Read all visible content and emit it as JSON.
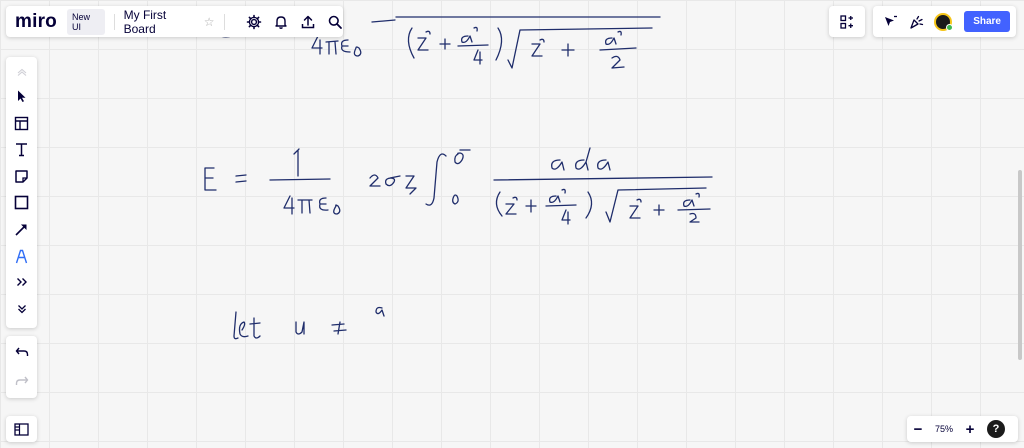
{
  "topbar": {
    "logo": "miro",
    "badge": "New UI",
    "board_title": "My First Board",
    "icons": [
      "settings-icon",
      "bell-icon",
      "upload-icon",
      "search-icon"
    ]
  },
  "topright": {
    "share_label": "Share",
    "icons": [
      "apps-icon",
      "cursor-icon",
      "reactions-icon",
      "avatar"
    ]
  },
  "toolbar": {
    "tools": [
      "chevron-up-icon",
      "select-icon",
      "template-icon",
      "text-icon",
      "sticky-note-icon",
      "shape-icon",
      "arrow-icon",
      "pen-icon",
      "more-icon",
      "chevron-down-icon"
    ]
  },
  "undo": [
    "undo-icon",
    "redo-icon"
  ],
  "zoom": {
    "level": "75%",
    "minus": "−",
    "plus": "+",
    "help": "?"
  },
  "colors": {
    "accent": "#4262ff",
    "ink": "#1f2d6b",
    "pen_tool": "#2f6df6"
  },
  "handwriting": {
    "line1_denominator": "(z² + a²/4) √(z² + a²/2)",
    "line1_lhs": "4πε₀",
    "line2_lhs": "E",
    "line2_equals": "=",
    "line2_numerator": "1",
    "line2_denominator": "4πε₀",
    "line2_factor": "2σz",
    "line2_upper": "a",
    "line2_lower": "0",
    "line2_integrand_num": "a da",
    "line3": "let u = a"
  }
}
